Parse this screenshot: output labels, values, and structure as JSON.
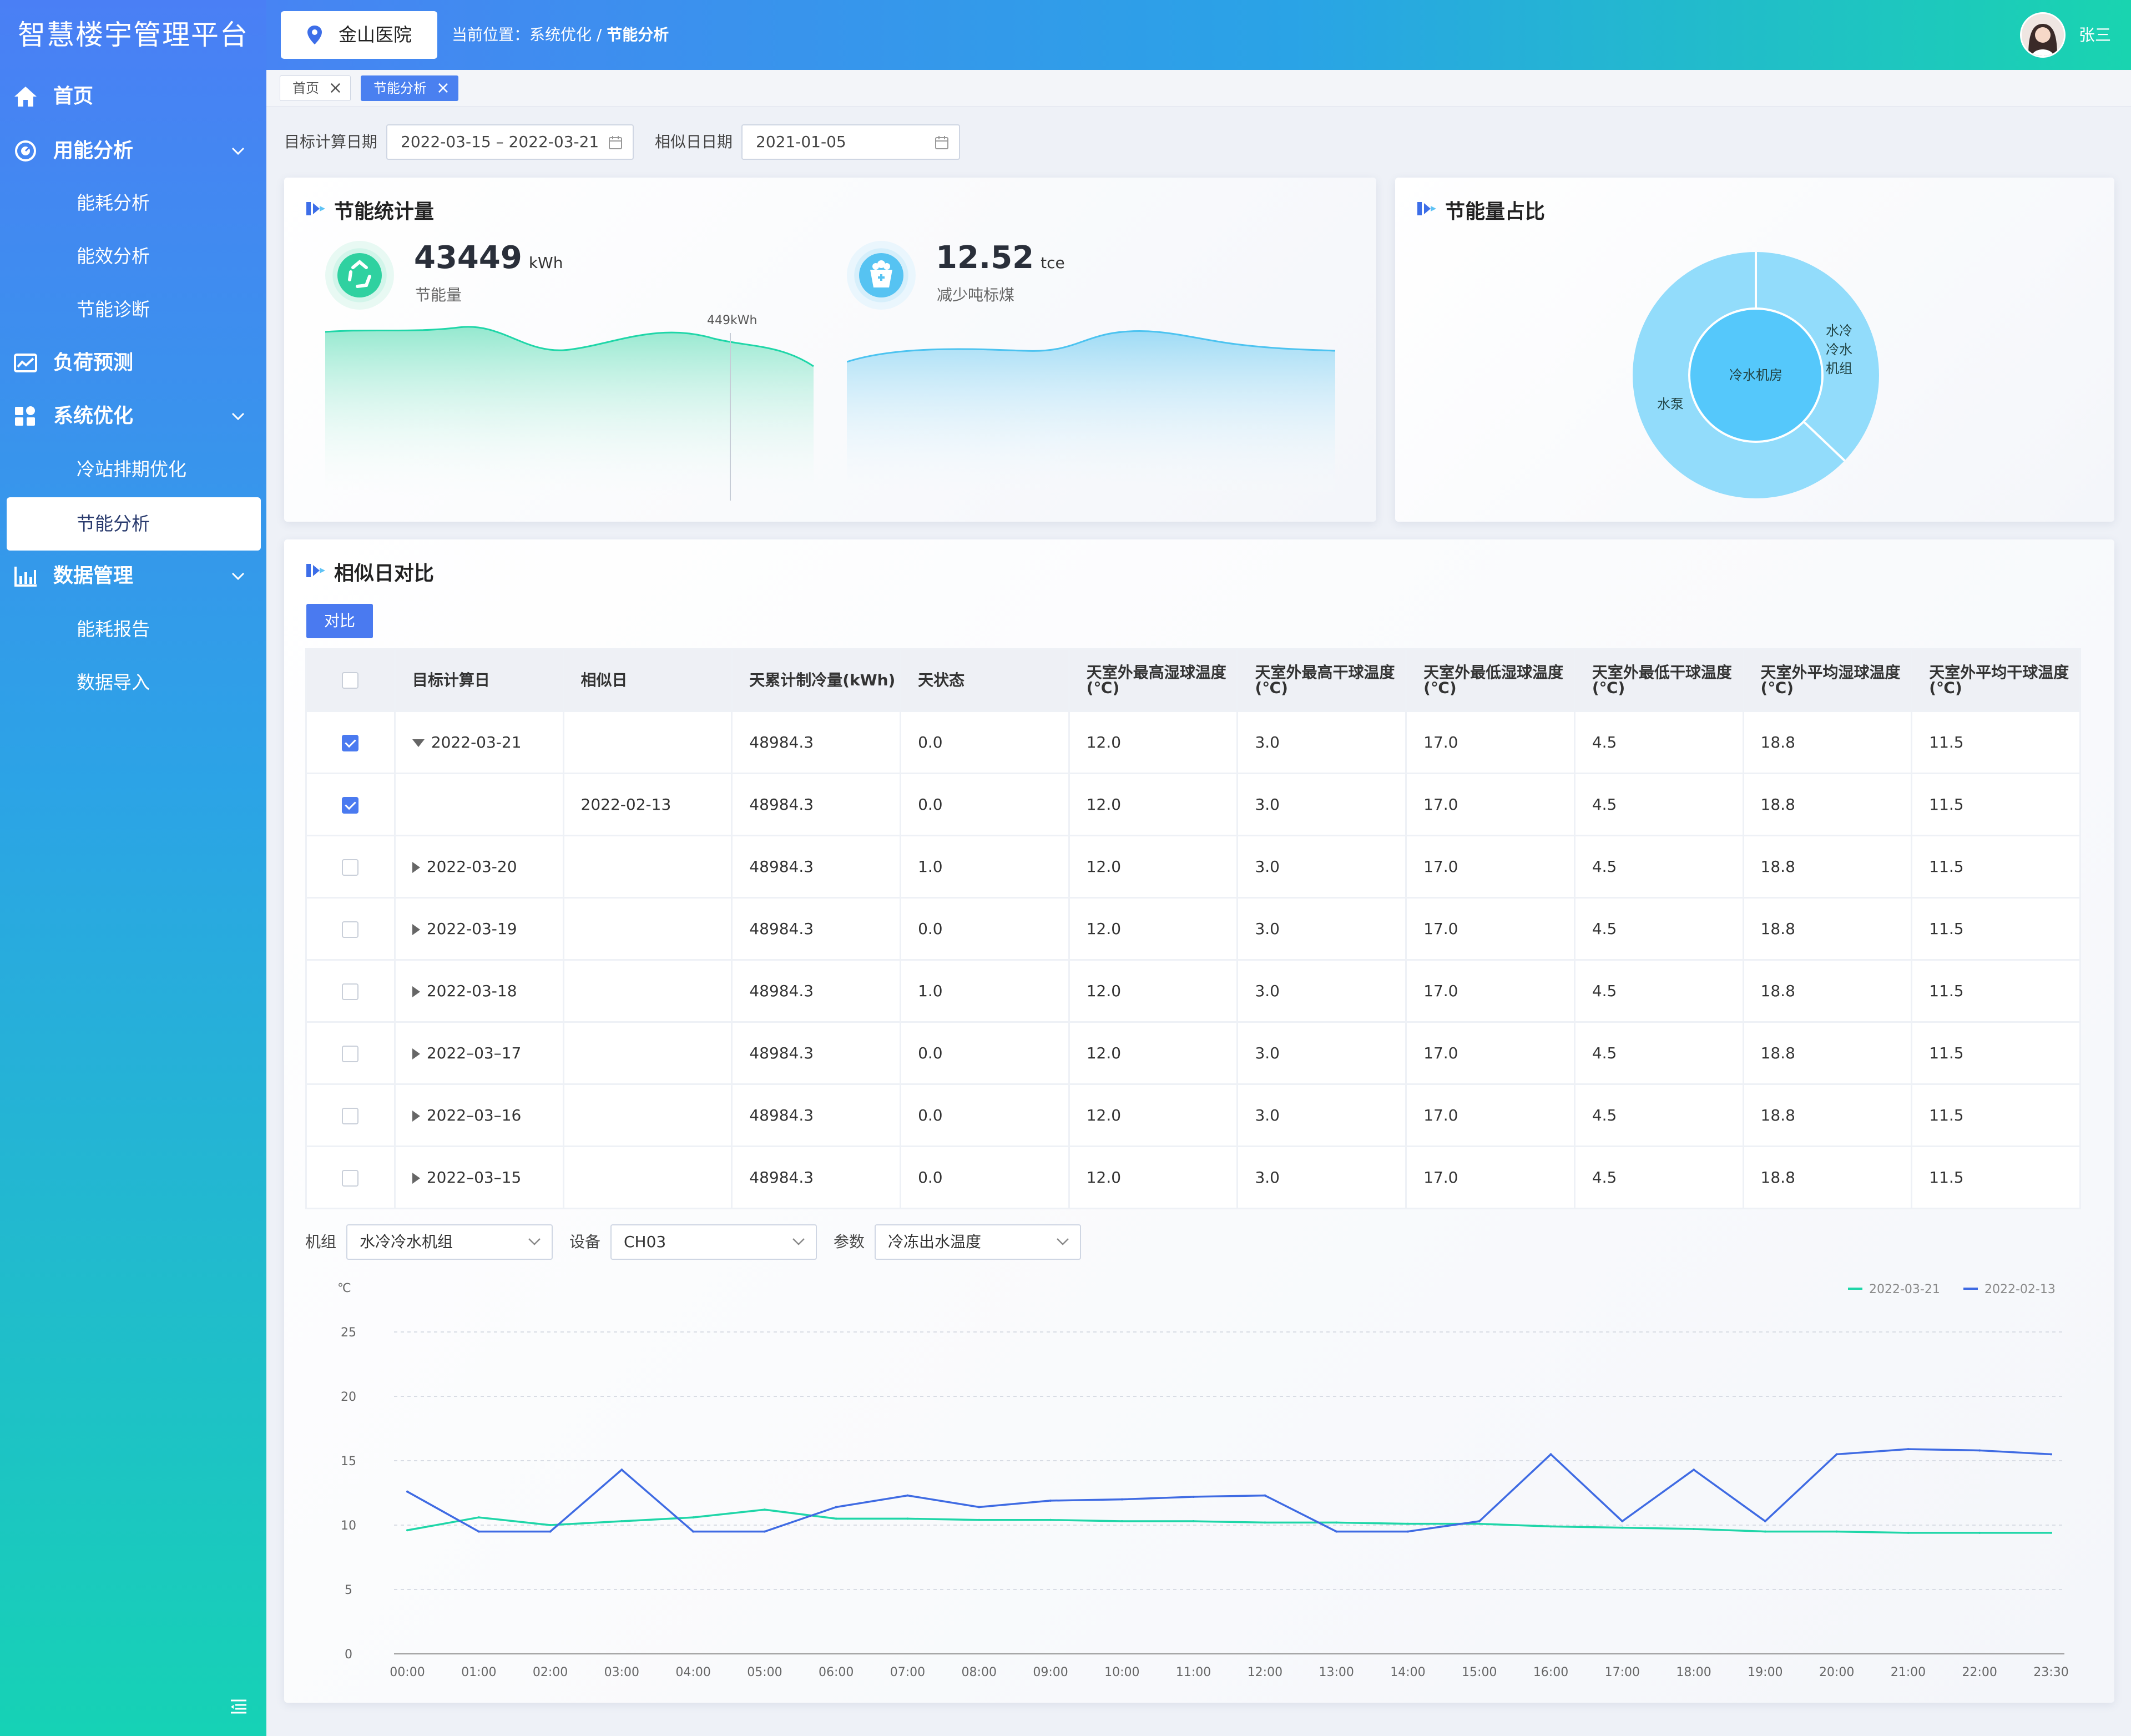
{
  "app_title": "智慧楼宇管理平台",
  "sidebar": {
    "home": "首页",
    "energy_analysis": "用能分析",
    "energy_consumption": "能耗分析",
    "energy_efficiency": "能效分析",
    "energy_diagnosis": "节能诊断",
    "load_forecast": "负荷预测",
    "system_optimization": "系统优化",
    "cold_station": "冷站排期优化",
    "saving_analysis": "节能分析",
    "data_management": "数据管理",
    "energy_report": "能耗报告",
    "data_import": "数据导入"
  },
  "header": {
    "hospital": "金山医院",
    "breadcrumb_prefix": "当前位置：系统优化 / ",
    "breadcrumb_current": "节能分析",
    "user": "张三"
  },
  "tabs": [
    "首页",
    "节能分析"
  ],
  "filters": {
    "target_date_label": "目标计算日期",
    "target_date_value": "2022-03-15 – 2022-03-21",
    "similar_date_label": "相似日日期",
    "similar_date_value": "2021-01-05"
  },
  "saving_stats": {
    "title": "节能统计量",
    "energy_value": "43449",
    "energy_unit": "kWh",
    "energy_label": "节能量",
    "tooltip": "449kWh",
    "coal_value": "12.52",
    "coal_unit": "tce",
    "coal_label": "减少吨标煤"
  },
  "saving_ratio": {
    "title": "节能量占比",
    "inner_label": "冷水机房",
    "labels": [
      "水冷冷水机组",
      "水泵"
    ],
    "colors": {
      "inner": "#55c8fb",
      "ring": "#92dcfb"
    }
  },
  "compare": {
    "title": "相似日对比",
    "button": "对比",
    "columns": [
      "目标计算日",
      "相似日",
      "天累计制冷量(kWh)",
      "天状态",
      "天室外最高湿球温度(℃)",
      "天室外最高干球温度(℃)",
      "天室外最低湿球温度(℃)",
      "天室外最低干球温度(℃)",
      "天室外平均湿球温度(℃)",
      "天室外平均干球温度(℃)"
    ],
    "rows": [
      {
        "checked": true,
        "expand": "down",
        "cells": [
          "2022-03-21",
          "",
          "48984.3",
          "0.0",
          "12.0",
          "3.0",
          "17.0",
          "4.5",
          "18.8",
          "11.5"
        ]
      },
      {
        "checked": true,
        "expand": "",
        "cells": [
          "",
          "2022-02-13",
          "48984.3",
          "0.0",
          "12.0",
          "3.0",
          "17.0",
          "4.5",
          "18.8",
          "11.5"
        ]
      },
      {
        "checked": false,
        "expand": "right",
        "cells": [
          "2022-03-20",
          "",
          "48984.3",
          "1.0",
          "12.0",
          "3.0",
          "17.0",
          "4.5",
          "18.8",
          "11.5"
        ]
      },
      {
        "checked": false,
        "expand": "right",
        "cells": [
          "2022-03-19",
          "",
          "48984.3",
          "0.0",
          "12.0",
          "3.0",
          "17.0",
          "4.5",
          "18.8",
          "11.5"
        ]
      },
      {
        "checked": false,
        "expand": "right",
        "cells": [
          "2022-03-18",
          "",
          "48984.3",
          "1.0",
          "12.0",
          "3.0",
          "17.0",
          "4.5",
          "18.8",
          "11.5"
        ]
      },
      {
        "checked": false,
        "expand": "right",
        "cells": [
          "2022–03–17",
          "",
          "48984.3",
          "0.0",
          "12.0",
          "3.0",
          "17.0",
          "4.5",
          "18.8",
          "11.5"
        ]
      },
      {
        "checked": false,
        "expand": "right",
        "cells": [
          "2022–03–16",
          "",
          "48984.3",
          "0.0",
          "12.0",
          "3.0",
          "17.0",
          "4.5",
          "18.8",
          "11.5"
        ]
      },
      {
        "checked": false,
        "expand": "right",
        "cells": [
          "2022–03–15",
          "",
          "48984.3",
          "0.0",
          "12.0",
          "3.0",
          "17.0",
          "4.5",
          "18.8",
          "11.5"
        ]
      }
    ]
  },
  "selectors": {
    "group_label": "机组",
    "group_value": "水冷冷水机组",
    "device_label": "设备",
    "device_value": "CH03",
    "param_label": "参数",
    "param_value": "冷冻出水温度"
  },
  "chart_data": {
    "type": "line",
    "ylabel": "℃",
    "ylim": [
      0,
      25
    ],
    "yticks": [
      0,
      5,
      10,
      15,
      20,
      25
    ],
    "categories": [
      "00:00",
      "01:00",
      "02:00",
      "03:00",
      "04:00",
      "05:00",
      "06:00",
      "07:00",
      "08:00",
      "09:00",
      "10:00",
      "11:00",
      "12:00",
      "13:00",
      "14:00",
      "15:00",
      "16:00",
      "17:00",
      "18:00",
      "19:00",
      "20:00",
      "21:00",
      "22:00",
      "23:30"
    ],
    "series": [
      {
        "name": "2022-03-21",
        "color": "#1fd6a8",
        "values": [
          9.6,
          10.6,
          10.0,
          10.3,
          10.6,
          11.2,
          10.5,
          10.5,
          10.4,
          10.4,
          10.3,
          10.3,
          10.2,
          10.2,
          10.1,
          10.1,
          9.9,
          9.8,
          9.7,
          9.5,
          9.5,
          9.4,
          9.4,
          9.4
        ]
      },
      {
        "name": "2022-02-13",
        "color": "#3f6be3",
        "values": [
          12.6,
          9.5,
          9.5,
          14.3,
          9.5,
          9.5,
          11.4,
          12.3,
          11.4,
          11.9,
          12.0,
          12.2,
          12.3,
          9.5,
          9.5,
          10.3,
          15.5,
          10.3,
          14.3,
          10.3,
          15.5,
          15.9,
          15.8,
          15.5
        ]
      }
    ]
  }
}
